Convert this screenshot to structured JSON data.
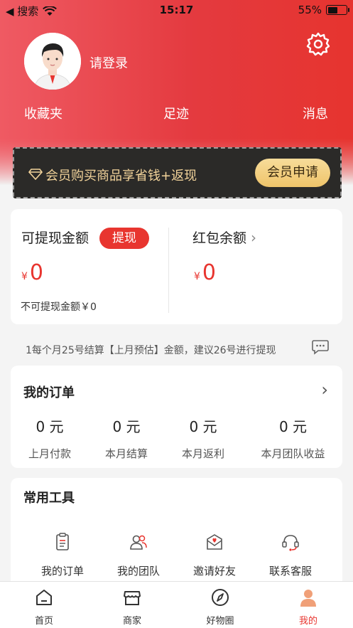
{
  "status_bar": {
    "back_label": "◀ 搜索",
    "time": "15:17",
    "battery": "55%",
    "battery_level": 0.55
  },
  "header": {
    "login_text": "请登录",
    "links": [
      "收藏夹",
      "足迹",
      "消息"
    ]
  },
  "vip_banner": {
    "text": "会员购买商品享省钱+返现",
    "button_label": "会员申请"
  },
  "wallet": {
    "withdrawable_label": "可提现金额",
    "withdraw_button": "提现",
    "withdrawable_amount": "0",
    "currency": "¥",
    "non_withdrawable_text": "不可提现金额￥0",
    "red_packet_label": "红包余额",
    "red_packet_amount": "0"
  },
  "notice": "1每个月25号结算【上月预估】金额，建议26号进行提现",
  "orders": {
    "title": "我的订单",
    "stats": [
      {
        "value": "0 元",
        "label": "上月付款"
      },
      {
        "value": "0 元",
        "label": "本月结算"
      },
      {
        "value": "0 元",
        "label": "本月返利"
      },
      {
        "value": "0 元",
        "label": "本月团队收益"
      }
    ]
  },
  "tools": {
    "title": "常用工具",
    "items": [
      {
        "label": "我的订单",
        "icon": "clipboard-icon"
      },
      {
        "label": "我的团队",
        "icon": "team-icon"
      },
      {
        "label": "邀请好友",
        "icon": "invite-envelope-icon"
      },
      {
        "label": "联系客服",
        "icon": "headset-icon"
      }
    ]
  },
  "tabbar": {
    "items": [
      {
        "label": "首页",
        "icon": "home-icon"
      },
      {
        "label": "商家",
        "icon": "store-icon"
      },
      {
        "label": "好物圈",
        "icon": "compass-icon"
      },
      {
        "label": "我的",
        "icon": "person-icon",
        "active": true
      }
    ]
  },
  "colors": {
    "brand_red": "#e8352f",
    "vip_gold": "#f2d39a",
    "vip_bg": "#2b2a28"
  }
}
